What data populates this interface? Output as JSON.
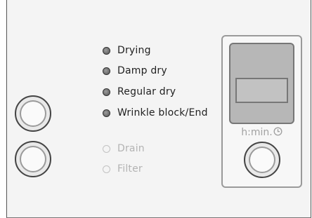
{
  "indicators": [
    {
      "label": "Drying",
      "lit": true
    },
    {
      "label": "Damp dry",
      "lit": true
    },
    {
      "label": "Regular dry",
      "lit": true
    },
    {
      "label": "Wrinkle block/End",
      "lit": true
    }
  ],
  "service_indicators": [
    {
      "label": "Drain",
      "lit": false
    },
    {
      "label": "Filter",
      "lit": false
    }
  ],
  "timer": {
    "unit_label": "h:min.",
    "icon": "clock-icon"
  }
}
